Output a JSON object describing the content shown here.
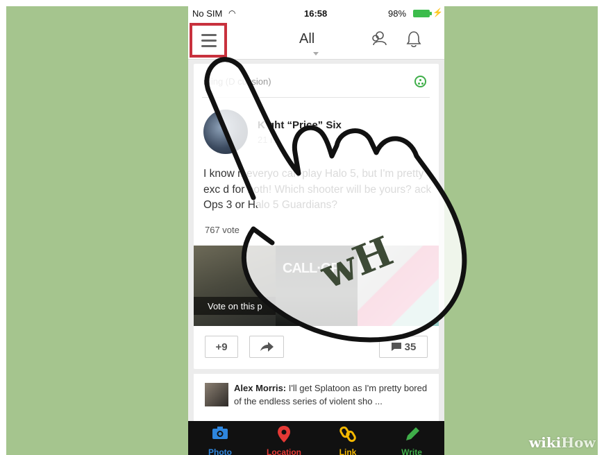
{
  "status_bar": {
    "carrier": "No SIM",
    "time": "16:58",
    "battery": "98%"
  },
  "nav": {
    "title": "All"
  },
  "post": {
    "category": "ming (D  cussion)",
    "author": "K  ght “Price” Six",
    "time": "21    rs",
    "body": "I know n   everyo   can play Halo 5, but I'm pretty exc   d for both! Which shooter will be yours?   ack Ops 3 or Halo 5 Guardians?",
    "vote_count": "767 vote",
    "poll_game_title": "CALL·OF",
    "poll_caption": "Vote on this p",
    "plus_label": "+9",
    "comments_count": "35"
  },
  "comment_preview": {
    "author": "Alex Morris:",
    "text": " I'll get Splatoon as I'm pretty bored of the endless series of violent sho ..."
  },
  "tabs": [
    {
      "label": "Photo",
      "color": "#2e86de"
    },
    {
      "label": "Location",
      "color": "#e53935"
    },
    {
      "label": "Link",
      "color": "#f5b800"
    },
    {
      "label": "Write",
      "color": "#3fae49"
    }
  ],
  "overlay": {
    "logo_letters": "wH"
  },
  "watermark": {
    "wiki": "wiki",
    "how": "How"
  },
  "colors": {
    "background": "#a5c58e",
    "highlight": "#c8313d",
    "accent_green": "#3fae49"
  }
}
